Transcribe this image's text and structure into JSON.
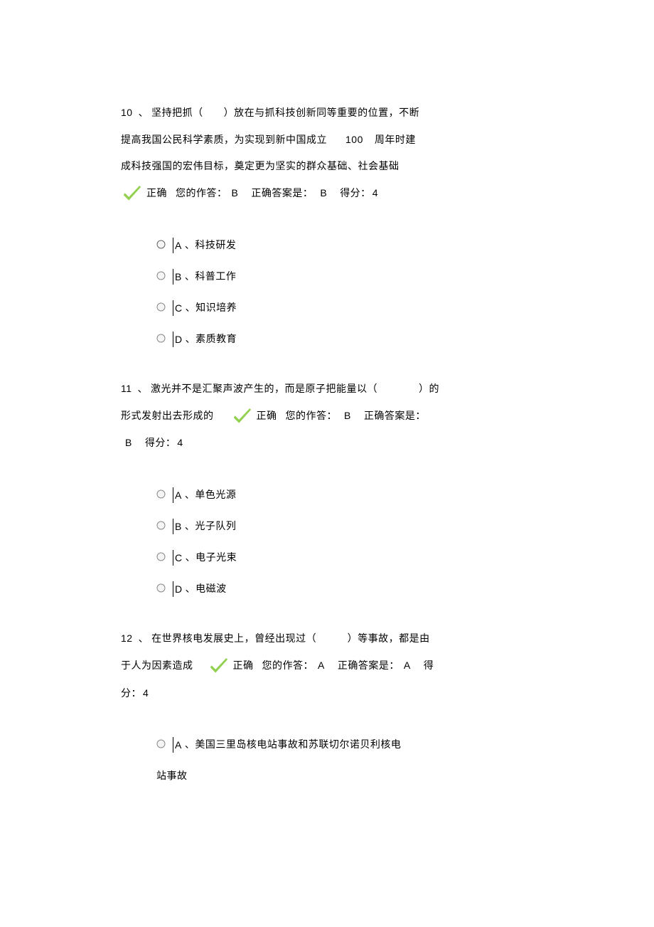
{
  "questions": [
    {
      "number": "10",
      "text_parts": [
        "坚持把抓（　　）放在与抓科技创新同等重要的位置，不断",
        "提高我国公民科学素质，为实现到新中国成立",
        "周年时建",
        "成科技强国的宏伟目标，奠定更为坚实的群众基础、社会基础"
      ],
      "inline_number": "100",
      "feedback": {
        "correct_label": "正确",
        "your_answer_label": "您的作答：",
        "your_answer": "B",
        "correct_answer_label": "正确答案是：",
        "correct_answer": "B",
        "score_label": "得分：",
        "score": "4"
      },
      "options": [
        {
          "letter": "A",
          "sep": "、",
          "text": "科技研发"
        },
        {
          "letter": "B",
          "sep": "、",
          "text": "科普工作"
        },
        {
          "letter": "C",
          "sep": "、",
          "text": "知识培养"
        },
        {
          "letter": "D",
          "sep": "、",
          "text": "素质教育"
        }
      ]
    },
    {
      "number": "11",
      "text_parts": [
        "激光并不是汇聚声波产生的，而是原子把能量以（　　　　）的",
        "形式发射出去形成的"
      ],
      "feedback": {
        "correct_label": "正确",
        "your_answer_label": "您的作答：",
        "your_answer": "B",
        "correct_answer_label": "正确答案是：",
        "correct_answer": "B",
        "score_label": "得分：",
        "score": "4"
      },
      "options": [
        {
          "letter": "A",
          "sep": "、",
          "text": "单色光源"
        },
        {
          "letter": "B",
          "sep": "、",
          "text": "光子队列"
        },
        {
          "letter": "C",
          "sep": "、",
          "text": "电子光束"
        },
        {
          "letter": "D",
          "sep": "、",
          "text": "电磁波"
        }
      ]
    },
    {
      "number": "12",
      "text_parts": [
        "在世界核电发展史上，曾经出现过（　　　）等事故，都是由",
        "于人为因素造成"
      ],
      "feedback": {
        "correct_label": "正确",
        "your_answer_label": "您的作答：",
        "your_answer": "A",
        "correct_answer_label": "正确答案是：",
        "correct_answer": "A",
        "score_label": "得",
        "score_label2": "分：",
        "score": "4"
      },
      "options": [
        {
          "letter": "A",
          "sep": "、",
          "text": "美国三里岛核电站事故和苏联切尔诺贝利核电",
          "cont": "站事故"
        }
      ]
    }
  ]
}
